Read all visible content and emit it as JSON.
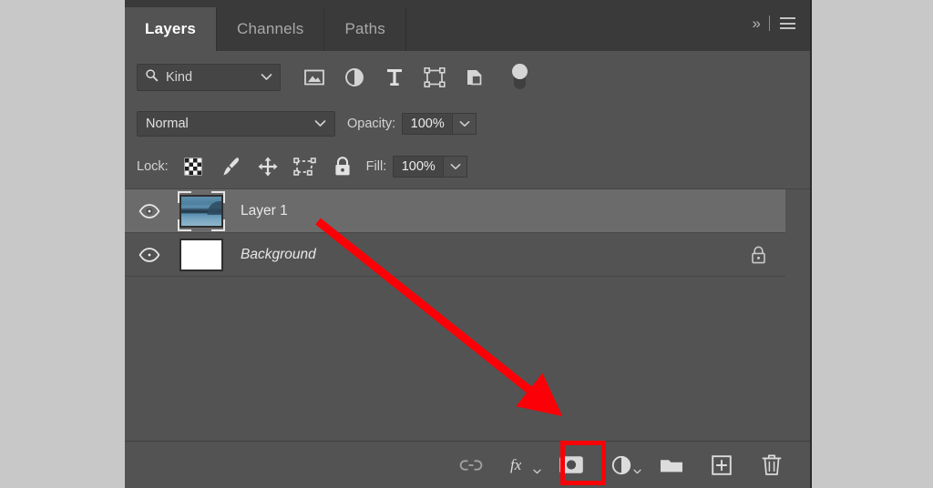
{
  "panel": {
    "title": "Layers",
    "tabs": [
      {
        "label": "Layers",
        "active": true
      },
      {
        "label": "Channels",
        "active": false
      },
      {
        "label": "Paths",
        "active": false
      }
    ],
    "collapse_label": "»",
    "menu_icon": "hamburger-menu-icon"
  },
  "filter_row": {
    "kind_label": "Kind",
    "search_icon": "search-icon",
    "chevron_icon": "chevron-down-icon",
    "filter_icons": [
      {
        "name": "filter-pixel-layers-icon",
        "title": "Filter for pixel layers"
      },
      {
        "name": "filter-adjustment-layers-icon",
        "title": "Filter for adjustment layers"
      },
      {
        "name": "filter-type-layers-icon",
        "title": "Filter for type layers"
      },
      {
        "name": "filter-shape-layers-icon",
        "title": "Filter for shape layers"
      },
      {
        "name": "filter-smart-object-icon",
        "title": "Filter for smart objects"
      }
    ],
    "toggle": {
      "name": "filter-enable-toggle",
      "state": "on"
    }
  },
  "blend_row": {
    "blend_mode": "Normal",
    "opacity_label": "Opacity:",
    "opacity_value": "100%"
  },
  "lock_row": {
    "lock_label": "Lock:",
    "lock_icons": [
      {
        "name": "lock-transparent-pixels-icon",
        "title": "Lock transparent pixels"
      },
      {
        "name": "lock-image-pixels-icon",
        "title": "Lock image pixels"
      },
      {
        "name": "lock-position-icon",
        "title": "Lock position"
      },
      {
        "name": "lock-artboard-nesting-icon",
        "title": "Prevent auto-nesting"
      },
      {
        "name": "lock-all-icon",
        "title": "Lock all"
      }
    ],
    "fill_label": "Fill:",
    "fill_value": "100%"
  },
  "layers": [
    {
      "name": "Layer 1",
      "visible": true,
      "selected": true,
      "italic": false,
      "locked": false,
      "thumbnail": "photo-thumbnail"
    },
    {
      "name": "Background",
      "visible": true,
      "selected": false,
      "italic": true,
      "locked": true,
      "thumbnail": "white-thumbnail"
    }
  ],
  "bottom_toolbar": {
    "buttons": [
      {
        "name": "link-layers-button",
        "icon": "link-icon",
        "label": "Link layers",
        "highlighted": false
      },
      {
        "name": "layer-style-button",
        "icon": "fx-icon",
        "label": "fx",
        "highlighted": false
      },
      {
        "name": "add-layer-mask-button",
        "icon": "layer-mask-icon",
        "label": "Add layer mask",
        "highlighted": true
      },
      {
        "name": "new-adjustment-layer-button",
        "icon": "adjustment-icon",
        "label": "Create new fill or adjustment layer",
        "highlighted": false
      },
      {
        "name": "new-group-button",
        "icon": "folder-icon",
        "label": "Create a new group",
        "highlighted": false
      },
      {
        "name": "new-layer-button",
        "icon": "plus-square-icon",
        "label": "Create a new layer",
        "highlighted": false
      },
      {
        "name": "delete-layer-button",
        "icon": "trash-icon",
        "label": "Delete layer",
        "highlighted": false
      }
    ]
  },
  "annotation": {
    "arrow_color": "#fb0007",
    "highlight_color": "#fb0007",
    "points_to": "add-layer-mask-button"
  }
}
